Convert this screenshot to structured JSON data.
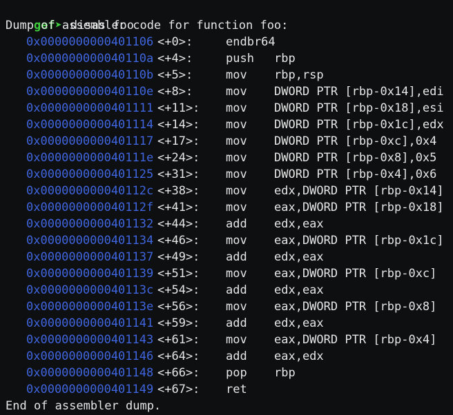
{
  "prompt": "gef➤",
  "command": "disas foo",
  "header": "Dump of assembler code for function foo:",
  "footer": "End of assembler dump.",
  "colors": {
    "background": "#0e0f10",
    "text": "#e6e6e6",
    "prompt": "#3fcf3f",
    "address": "#3f66e0"
  },
  "instructions": [
    {
      "addr": "0x0000000000401106",
      "off": "<+0>:",
      "mnem": "endbr64",
      "ops": ""
    },
    {
      "addr": "0x000000000040110a",
      "off": "<+4>:",
      "mnem": "push",
      "ops": "rbp"
    },
    {
      "addr": "0x000000000040110b",
      "off": "<+5>:",
      "mnem": "mov",
      "ops": "rbp,rsp"
    },
    {
      "addr": "0x000000000040110e",
      "off": "<+8>:",
      "mnem": "mov",
      "ops": "DWORD PTR [rbp-0x14],edi"
    },
    {
      "addr": "0x0000000000401111",
      "off": "<+11>:",
      "mnem": "mov",
      "ops": "DWORD PTR [rbp-0x18],esi"
    },
    {
      "addr": "0x0000000000401114",
      "off": "<+14>:",
      "mnem": "mov",
      "ops": "DWORD PTR [rbp-0x1c],edx"
    },
    {
      "addr": "0x0000000000401117",
      "off": "<+17>:",
      "mnem": "mov",
      "ops": "DWORD PTR [rbp-0xc],0x4"
    },
    {
      "addr": "0x000000000040111e",
      "off": "<+24>:",
      "mnem": "mov",
      "ops": "DWORD PTR [rbp-0x8],0x5"
    },
    {
      "addr": "0x0000000000401125",
      "off": "<+31>:",
      "mnem": "mov",
      "ops": "DWORD PTR [rbp-0x4],0x6"
    },
    {
      "addr": "0x000000000040112c",
      "off": "<+38>:",
      "mnem": "mov",
      "ops": "edx,DWORD PTR [rbp-0x14]"
    },
    {
      "addr": "0x000000000040112f",
      "off": "<+41>:",
      "mnem": "mov",
      "ops": "eax,DWORD PTR [rbp-0x18]"
    },
    {
      "addr": "0x0000000000401132",
      "off": "<+44>:",
      "mnem": "add",
      "ops": "edx,eax"
    },
    {
      "addr": "0x0000000000401134",
      "off": "<+46>:",
      "mnem": "mov",
      "ops": "eax,DWORD PTR [rbp-0x1c]"
    },
    {
      "addr": "0x0000000000401137",
      "off": "<+49>:",
      "mnem": "add",
      "ops": "edx,eax"
    },
    {
      "addr": "0x0000000000401139",
      "off": "<+51>:",
      "mnem": "mov",
      "ops": "eax,DWORD PTR [rbp-0xc]"
    },
    {
      "addr": "0x000000000040113c",
      "off": "<+54>:",
      "mnem": "add",
      "ops": "edx,eax"
    },
    {
      "addr": "0x000000000040113e",
      "off": "<+56>:",
      "mnem": "mov",
      "ops": "eax,DWORD PTR [rbp-0x8]"
    },
    {
      "addr": "0x0000000000401141",
      "off": "<+59>:",
      "mnem": "add",
      "ops": "edx,eax"
    },
    {
      "addr": "0x0000000000401143",
      "off": "<+61>:",
      "mnem": "mov",
      "ops": "eax,DWORD PTR [rbp-0x4]"
    },
    {
      "addr": "0x0000000000401146",
      "off": "<+64>:",
      "mnem": "add",
      "ops": "eax,edx"
    },
    {
      "addr": "0x0000000000401148",
      "off": "<+66>:",
      "mnem": "pop",
      "ops": "rbp"
    },
    {
      "addr": "0x0000000000401149",
      "off": "<+67>:",
      "mnem": "ret",
      "ops": ""
    }
  ]
}
